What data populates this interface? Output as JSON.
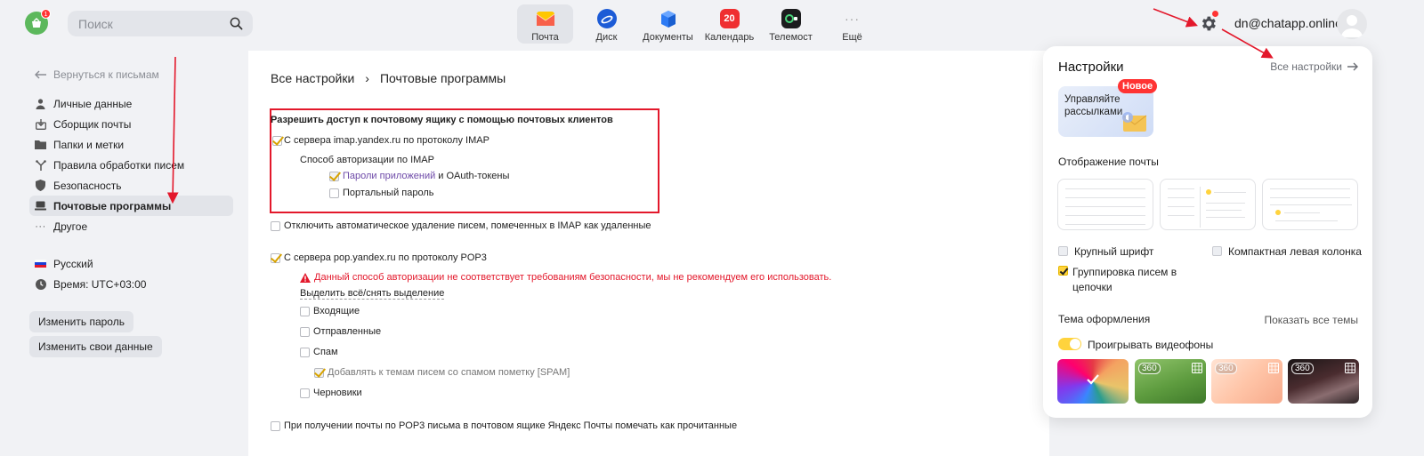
{
  "header": {
    "search_placeholder": "Поиск",
    "services": [
      {
        "label": "Почта",
        "icon": "mail-icon",
        "active": true
      },
      {
        "label": "Диск",
        "icon": "disk-icon",
        "active": false
      },
      {
        "label": "Документы",
        "icon": "documents-icon",
        "active": false
      },
      {
        "label": "Календарь",
        "icon": "calendar-icon",
        "badge": "20",
        "active": false
      },
      {
        "label": "Телемост",
        "icon": "telemost-icon",
        "active": false
      },
      {
        "label": "Ещё",
        "icon": "more-icon",
        "active": false
      }
    ],
    "user_email": "dn@chatapp.online",
    "logo_badge": "1"
  },
  "sidebar": {
    "back_label": "Вернуться к письмам",
    "items": [
      {
        "label": "Личные данные",
        "icon": "person-icon"
      },
      {
        "label": "Сборщик почты",
        "icon": "inbox-download-icon"
      },
      {
        "label": "Папки и метки",
        "icon": "folder-icon"
      },
      {
        "label": "Правила обработки писем",
        "icon": "rules-icon"
      },
      {
        "label": "Безопасность",
        "icon": "shield-icon"
      },
      {
        "label": "Почтовые программы",
        "icon": "laptop-icon",
        "active": true
      },
      {
        "label": "Другое",
        "icon": "dots-icon"
      }
    ],
    "language": "Русский",
    "timezone": "Время: UTC+03:00",
    "change_password": "Изменить пароль",
    "change_data": "Изменить свои данные"
  },
  "main": {
    "breadcrumb_root": "Все настройки",
    "breadcrumb_current": "Почтовые программы",
    "allow_access_title": "Разрешить доступ к почтовому ящику с помощью почтовых клиентов",
    "imap_label": "С сервера imap.yandex.ru по протоколу IMAP",
    "imap_auth_title": "Способ авторизации по IMAP",
    "app_passwords_link": "Пароли приложений",
    "app_passwords_rest": " и OAuth-токены",
    "portal_password": "Портальный пароль",
    "disable_autodelete": "Отключить автоматическое удаление писем, помеченных в IMAP как удаленные",
    "pop3_label": "С сервера pop.yandex.ru по протоколу POP3",
    "pop3_warning": "Данный способ авторизации не соответствует требованиям безопасности, мы не рекомендуем его использовать.",
    "select_all": "Выделить всё/снять выделение",
    "folders": {
      "inbox": "Входящие",
      "sent": "Отправленные",
      "spam": "Спам",
      "spam_tag": "Добавлять к темам писем со спамом пометку [SPAM]",
      "drafts": "Черновики"
    },
    "mark_read": "При получении почты по POP3 письма в почтовом ящике Яндекс Почты помечать как прочитанные"
  },
  "panel": {
    "title": "Настройки",
    "all_settings": "Все настройки",
    "promo_text": "Управляйте рассылками",
    "new_badge": "Новое",
    "display_title": "Отображение почты",
    "large_font": "Крупный шрифт",
    "compact_column": "Компактная левая колонка",
    "group_threads": "Группировка писем в цепочки",
    "theme_title": "Тема оформления",
    "show_all_themes": "Показать все темы",
    "video_bg": "Проигрывать видеофоны",
    "theme_badge": "360"
  },
  "colors": {
    "accent_yellow": "#ffd33d",
    "warning_red": "#e3182b",
    "link_purple": "#6e4aa8"
  }
}
